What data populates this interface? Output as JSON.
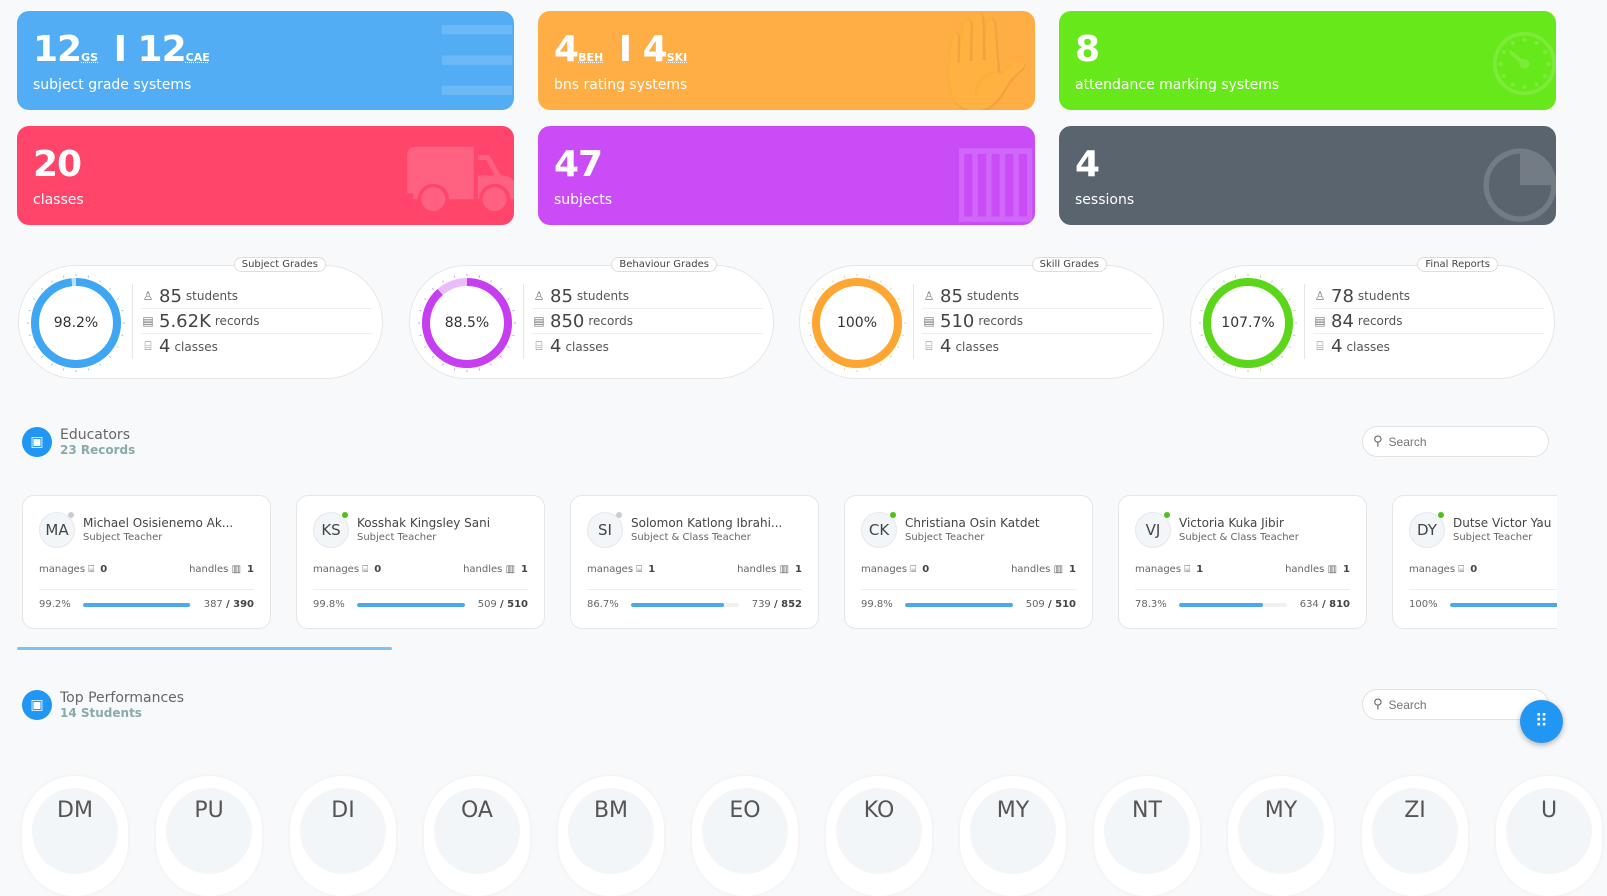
{
  "stats": [
    {
      "parts": [
        {
          "n": "12",
          "s": "GS"
        },
        {
          "n": "12",
          "s": "CAE"
        }
      ],
      "label": "subject grade systems",
      "color": "#52adf5",
      "icon": "table-icon"
    },
    {
      "parts": [
        {
          "n": "4",
          "s": "BEH"
        },
        {
          "n": "4",
          "s": "SKI"
        }
      ],
      "label": "bns rating systems",
      "color": "#ffae45",
      "icon": "hand-icon"
    },
    {
      "parts": [
        {
          "n": "8",
          "s": ""
        }
      ],
      "label": "attendance marking systems",
      "color": "#66e81a",
      "icon": "timer-icon"
    },
    {
      "parts": [
        {
          "n": "20",
          "s": ""
        }
      ],
      "label": "classes",
      "color": "#ff4569",
      "icon": "classroom-icon"
    },
    {
      "parts": [
        {
          "n": "47",
          "s": ""
        }
      ],
      "label": "subjects",
      "color": "#c94cf7",
      "icon": "books-icon"
    },
    {
      "parts": [
        {
          "n": "4",
          "s": ""
        }
      ],
      "label": "sessions",
      "color": "#5a646e",
      "icon": "dashboard-gauge-icon"
    }
  ],
  "gauges": [
    {
      "title": "Subject Grades",
      "percent": "98.2%",
      "value": 98.2,
      "color": "#3ea6f2",
      "students": "85",
      "students_label": "students",
      "records": "5.62K",
      "records_label": "records",
      "classes": "4",
      "classes_label": "classes"
    },
    {
      "title": "Behaviour Grades",
      "percent": "88.5%",
      "value": 88.5,
      "color": "#c53ff0",
      "students": "85",
      "students_label": "students",
      "records": "850",
      "records_label": "records",
      "classes": "4",
      "classes_label": "classes"
    },
    {
      "title": "Skill Grades",
      "percent": "100%",
      "value": 100,
      "color": "#ffa531",
      "students": "85",
      "students_label": "students",
      "records": "510",
      "records_label": "records",
      "classes": "4",
      "classes_label": "classes"
    },
    {
      "title": "Final Reports",
      "percent": "107.7%",
      "value": 107.7,
      "color": "#5cd61a",
      "students": "78",
      "students_label": "students",
      "records": "84",
      "records_label": "records",
      "classes": "4",
      "classes_label": "classes"
    }
  ],
  "educators": {
    "title": "Educators",
    "subtitle": "23 Records",
    "search_placeholder": "Search",
    "manages_label": "manages",
    "handles_label": "handles",
    "items": [
      {
        "initials": "MA",
        "name": "Michael Osisienemo Ak...",
        "role": "Subject Teacher",
        "online": false,
        "manages": "0",
        "handles": "1",
        "percent": "99.2%",
        "progress": 99.2,
        "done": "387",
        "total": "/ 390"
      },
      {
        "initials": "KS",
        "name": "Kosshak Kingsley Sani",
        "role": "Subject Teacher",
        "online": true,
        "manages": "0",
        "handles": "1",
        "percent": "99.8%",
        "progress": 99.8,
        "done": "509",
        "total": "/ 510"
      },
      {
        "initials": "SI",
        "name": "Solomon Katlong Ibrahi...",
        "role": "Subject & Class Teacher",
        "online": false,
        "manages": "1",
        "handles": "1",
        "percent": "86.7%",
        "progress": 86.7,
        "done": "739",
        "total": "/ 852"
      },
      {
        "initials": "CK",
        "name": "Christiana Osin Katdet",
        "role": "Subject Teacher",
        "online": true,
        "manages": "0",
        "handles": "1",
        "percent": "99.8%",
        "progress": 99.8,
        "done": "509",
        "total": "/ 510"
      },
      {
        "initials": "VJ",
        "name": "Victoria Kuka Jibir",
        "role": "Subject & Class Teacher",
        "online": true,
        "manages": "1",
        "handles": "1",
        "percent": "78.3%",
        "progress": 78.3,
        "done": "634",
        "total": "/ 810"
      },
      {
        "initials": "DY",
        "name": "Dutse Victor Yau",
        "role": "Subject Teacher",
        "online": true,
        "manages": "0",
        "handles": "",
        "percent": "100%",
        "progress": 100,
        "done": "",
        "total": ""
      }
    ]
  },
  "top": {
    "title": "Top Performances",
    "subtitle": "14 Students",
    "search_placeholder": "Search",
    "students": [
      "DM",
      "PU",
      "DI",
      "OA",
      "BM",
      "EO",
      "KO",
      "MY",
      "NT",
      "MY",
      "ZI",
      "U"
    ]
  },
  "colors": {
    "accent": "#2196f3",
    "online": "#4cc21a",
    "offline": "#cccccc"
  }
}
